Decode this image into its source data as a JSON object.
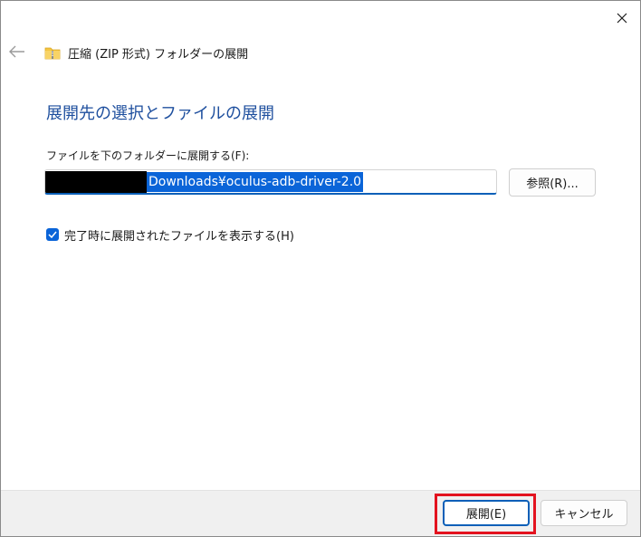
{
  "window": {
    "title": "圧縮 (ZIP 形式) フォルダーの展開",
    "close_icon": "close-icon",
    "back_icon": "back-arrow-icon",
    "folder_icon": "zip-folder-icon"
  },
  "main": {
    "heading": "展開先の選択とファイルの展開",
    "field_label": "ファイルを下のフォルダーに展開する(F):",
    "path_value_visible": "Downloads¥oculus-adb-driver-2.0",
    "browse_label": "参照(R)...",
    "checkbox": {
      "label": "完了時に展開されたファイルを表示する(H)",
      "checked": true
    }
  },
  "footer": {
    "extract_label": "展開(E)",
    "cancel_label": "キャンセル"
  },
  "colors": {
    "accent": "#0a64d8",
    "heading": "#1e4f9e",
    "highlight": "#e3131f",
    "footer_bg": "#f0f0f0"
  }
}
